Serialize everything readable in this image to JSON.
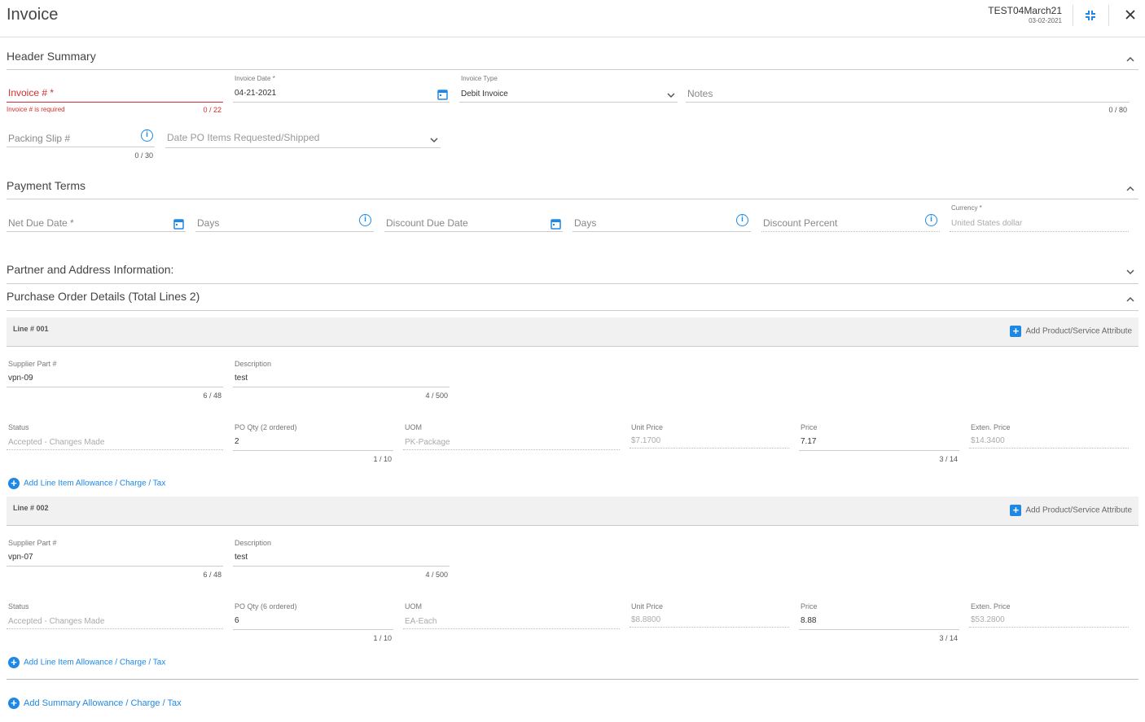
{
  "header": {
    "title": "Invoice",
    "doc_id": "TEST04March21",
    "doc_date": "03-02-2021",
    "collapse_icon": "collapse-icon",
    "close_icon": "close-icon"
  },
  "header_summary": {
    "title": "Header Summary",
    "invoice_number": {
      "label": "Invoice # *",
      "error": "Invoice # is required",
      "counter": "0 / 22"
    },
    "invoice_date": {
      "label": "Invoice Date *",
      "value": "04-21-2021"
    },
    "invoice_type": {
      "label": "Invoice Type",
      "value": "Debit Invoice"
    },
    "notes": {
      "placeholder": "Notes",
      "counter": "0 / 80"
    },
    "packing_slip": {
      "placeholder": "Packing Slip #",
      "counter": "0 / 30"
    },
    "date_po_items": {
      "placeholder": "Date PO Items Requested/Shipped"
    }
  },
  "payment_terms": {
    "title": "Payment Terms",
    "net_due_date": {
      "placeholder": "Net Due Date *"
    },
    "days_1": {
      "placeholder": "Days"
    },
    "discount_due_date": {
      "placeholder": "Discount Due Date"
    },
    "days_2": {
      "placeholder": "Days"
    },
    "discount_percent": {
      "placeholder": "Discount Percent"
    },
    "currency": {
      "label": "Currency *",
      "value": "United States dollar"
    }
  },
  "partner": {
    "title": "Partner and Address Information:"
  },
  "po_details": {
    "title": "Purchase Order Details (Total Lines 2)",
    "add_attr_label": "Add Product/Service Attribute",
    "add_line_allowance": "Add Line Item Allowance / Charge / Tax",
    "labels": {
      "supplier_part": "Supplier Part #",
      "description": "Description",
      "status": "Status",
      "uom": "UOM",
      "unit_price": "Unit Price",
      "price": "Price",
      "exten_price": "Exten. Price"
    },
    "lines": [
      {
        "title": "Line # 001",
        "supplier_part": "vpn-09",
        "supplier_part_counter": "6 / 48",
        "description": "test",
        "description_counter": "4 / 500",
        "status": "Accepted - Changes Made",
        "po_qty_label": "PO Qty (2 ordered)",
        "po_qty": "2",
        "po_qty_counter": "1 / 10",
        "uom": "PK-Package",
        "unit_price": "$7.1700",
        "price": "7.17",
        "price_counter": "3 / 14",
        "exten_price": "$14.3400"
      },
      {
        "title": "Line # 002",
        "supplier_part": "vpn-07",
        "supplier_part_counter": "6 / 48",
        "description": "test",
        "description_counter": "4 / 500",
        "status": "Accepted - Changes Made",
        "po_qty_label": "PO Qty (6 ordered)",
        "po_qty": "6",
        "po_qty_counter": "1 / 10",
        "uom": "EA-Each",
        "unit_price": "$8.8800",
        "price": "8.88",
        "price_counter": "3 / 14",
        "exten_price": "$53.2800"
      }
    ]
  },
  "summary_allowance": "Add Summary Allowance / Charge / Tax",
  "colors": {
    "accent": "#1e88e5",
    "error": "#d32f2f"
  }
}
